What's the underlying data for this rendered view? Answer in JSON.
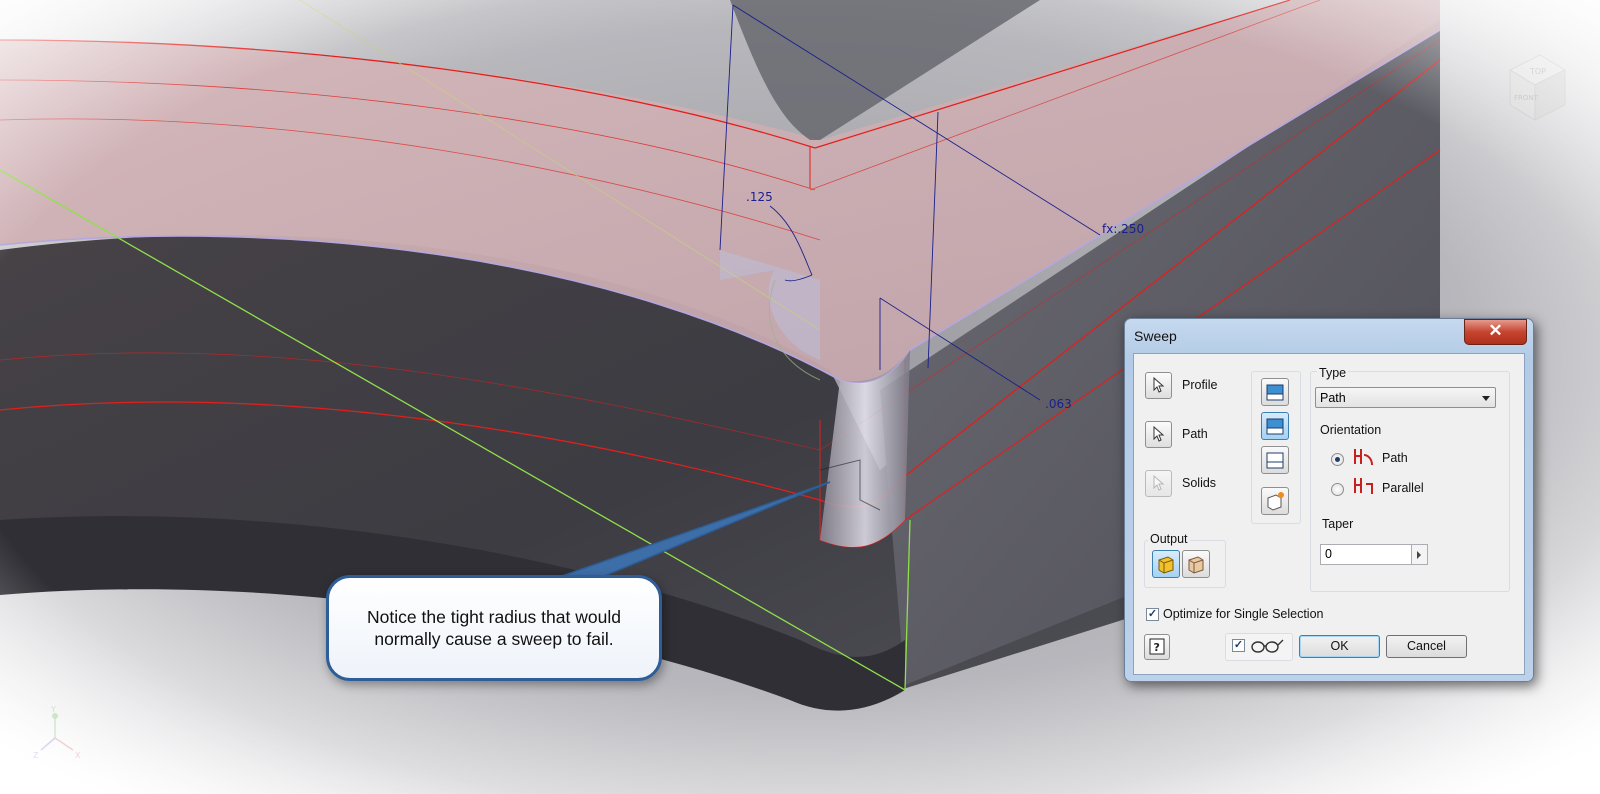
{
  "viewport": {
    "dimensions": [
      ".125",
      "fx:.250",
      ".063"
    ],
    "viewcube": {
      "top": "TOP",
      "front": "FRONT"
    },
    "axes": {
      "x": "X",
      "y": "Y",
      "z": "Z"
    }
  },
  "callout": {
    "text": "Notice the tight radius that would normally cause a sweep to fail."
  },
  "dialog": {
    "title": "Sweep",
    "close_symbol": "✕",
    "selectors": [
      {
        "label": "Profile",
        "icon": "select-arrow-icon"
      },
      {
        "label": "Path",
        "icon": "select-arrow-icon"
      },
      {
        "label": "Solids",
        "icon": "select-arrow-icon"
      }
    ],
    "output_label": "Output",
    "type_label": "Type",
    "type_value": "Path",
    "orientation_label": "Orientation",
    "orientation_options": [
      "Path",
      "Parallel"
    ],
    "orientation_selected": "Path",
    "taper_label": "Taper",
    "taper_value": "0",
    "optimize_label": "Optimize for Single Selection",
    "optimize_checked": true,
    "preview_checked": true,
    "ok_label": "OK",
    "cancel_label": "Cancel",
    "help_symbol": "?"
  },
  "colors": {
    "model_dark": "#55555d",
    "model_pink": "#c9a9ad",
    "edge_red": "#e0201c",
    "dimension_blue": "#1b1f8a",
    "axis_green": "#8fe04a",
    "callout_border": "#2d5e98"
  }
}
